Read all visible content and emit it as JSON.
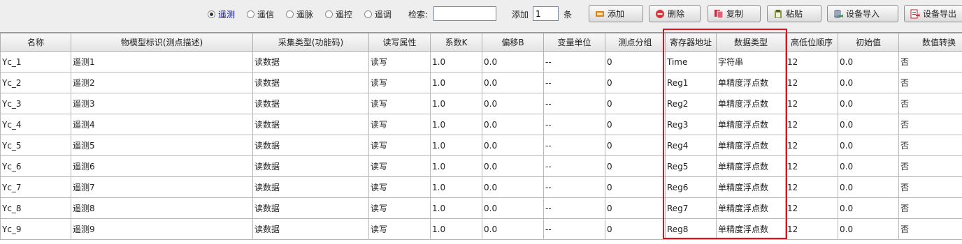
{
  "toolbar": {
    "radios": [
      {
        "label": "遥测",
        "checked": true
      },
      {
        "label": "遥信",
        "checked": false
      },
      {
        "label": "遥脉",
        "checked": false
      },
      {
        "label": "遥控",
        "checked": false
      },
      {
        "label": "遥调",
        "checked": false
      }
    ],
    "search_label": "检索:",
    "search_value": "",
    "add_label": "添加",
    "add_count": "1",
    "add_unit": "条",
    "buttons": [
      {
        "label": "添加",
        "icon": "add-icon"
      },
      {
        "label": "删除",
        "icon": "delete-icon"
      },
      {
        "label": "复制",
        "icon": "copy-icon"
      },
      {
        "label": "粘贴",
        "icon": "paste-icon"
      },
      {
        "label": "设备导入",
        "icon": "import-icon"
      },
      {
        "label": "设备导出",
        "icon": "export-icon"
      }
    ]
  },
  "table": {
    "columns": [
      "名称",
      "物模型标识(测点描述)",
      "采集类型(功能码)",
      "读写属性",
      "系数K",
      "偏移B",
      "变量单位",
      "测点分组",
      "寄存器地址",
      "数据类型",
      "高低位顺序",
      "初始值",
      "数值转换"
    ],
    "rows": [
      [
        "Yc_1",
        "遥测1",
        "读数据",
        "读写",
        "1.0",
        "0.0",
        "--",
        "0",
        "Time",
        "字符串",
        "12",
        "0.0",
        "否"
      ],
      [
        "Yc_2",
        "遥测2",
        "读数据",
        "读写",
        "1.0",
        "0.0",
        "--",
        "0",
        "Reg1",
        "单精度浮点数",
        "12",
        "0.0",
        "否"
      ],
      [
        "Yc_3",
        "遥测3",
        "读数据",
        "读写",
        "1.0",
        "0.0",
        "--",
        "0",
        "Reg2",
        "单精度浮点数",
        "12",
        "0.0",
        "否"
      ],
      [
        "Yc_4",
        "遥测4",
        "读数据",
        "读写",
        "1.0",
        "0.0",
        "--",
        "0",
        "Reg3",
        "单精度浮点数",
        "12",
        "0.0",
        "否"
      ],
      [
        "Yc_5",
        "遥测5",
        "读数据",
        "读写",
        "1.0",
        "0.0",
        "--",
        "0",
        "Reg4",
        "单精度浮点数",
        "12",
        "0.0",
        "否"
      ],
      [
        "Yc_6",
        "遥测6",
        "读数据",
        "读写",
        "1.0",
        "0.0",
        "--",
        "0",
        "Reg5",
        "单精度浮点数",
        "12",
        "0.0",
        "否"
      ],
      [
        "Yc_7",
        "遥测7",
        "读数据",
        "读写",
        "1.0",
        "0.0",
        "--",
        "0",
        "Reg6",
        "单精度浮点数",
        "12",
        "0.0",
        "否"
      ],
      [
        "Yc_8",
        "遥测8",
        "读数据",
        "读写",
        "1.0",
        "0.0",
        "--",
        "0",
        "Reg7",
        "单精度浮点数",
        "12",
        "0.0",
        "否"
      ],
      [
        "Yc_9",
        "遥测9",
        "读数据",
        "读写",
        "1.0",
        "0.0",
        "--",
        "0",
        "Reg8",
        "单精度浮点数",
        "12",
        "0.0",
        "否"
      ]
    ]
  },
  "colors": {
    "highlight": "#e0101e",
    "selected_radio_text": "#1010c0"
  }
}
